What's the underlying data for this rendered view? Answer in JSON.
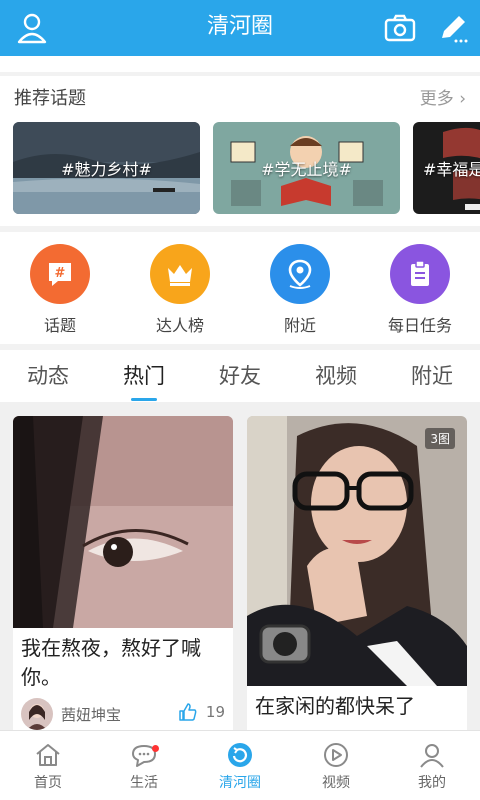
{
  "header": {
    "title": "清河圈",
    "left_icon": "user-icon",
    "right_icons": [
      "camera-icon",
      "edit-icon"
    ],
    "accent": "#2aa6ea"
  },
  "topics": {
    "heading": "推荐话题",
    "more": "更多",
    "items": [
      {
        "label": "#魅力乡村#"
      },
      {
        "label": "#学无止境#"
      },
      {
        "label": "#幸福是"
      }
    ]
  },
  "shortcuts": [
    {
      "label": "话题",
      "icon": "hash-chat-icon",
      "color": "#f36b32"
    },
    {
      "label": "达人榜",
      "icon": "crown-icon",
      "color": "#f8a51b"
    },
    {
      "label": "附近",
      "icon": "location-pin-icon",
      "color": "#2b8fea"
    },
    {
      "label": "每日任务",
      "icon": "clipboard-icon",
      "color": "#8a55e0"
    }
  ],
  "tabs": [
    {
      "label": "动态"
    },
    {
      "label": "热门"
    },
    {
      "label": "好友"
    },
    {
      "label": "视频"
    },
    {
      "label": "附近"
    }
  ],
  "active_tab": "热门",
  "feed": [
    {
      "caption_line1": "我在熬夜，熬好了喊",
      "caption_line2": "你。",
      "author": "茜妞坤宝",
      "likes": "19"
    },
    {
      "caption_line1": "在家闲的都快呆了",
      "badge": "3图"
    }
  ],
  "bottom_nav": [
    {
      "label": "首页",
      "icon": "home-icon"
    },
    {
      "label": "生活",
      "icon": "chat-bubble-icon"
    },
    {
      "label": "清河圈",
      "icon": "circle-refresh-icon"
    },
    {
      "label": "视频",
      "icon": "play-icon"
    },
    {
      "label": "我的",
      "icon": "profile-icon"
    }
  ]
}
